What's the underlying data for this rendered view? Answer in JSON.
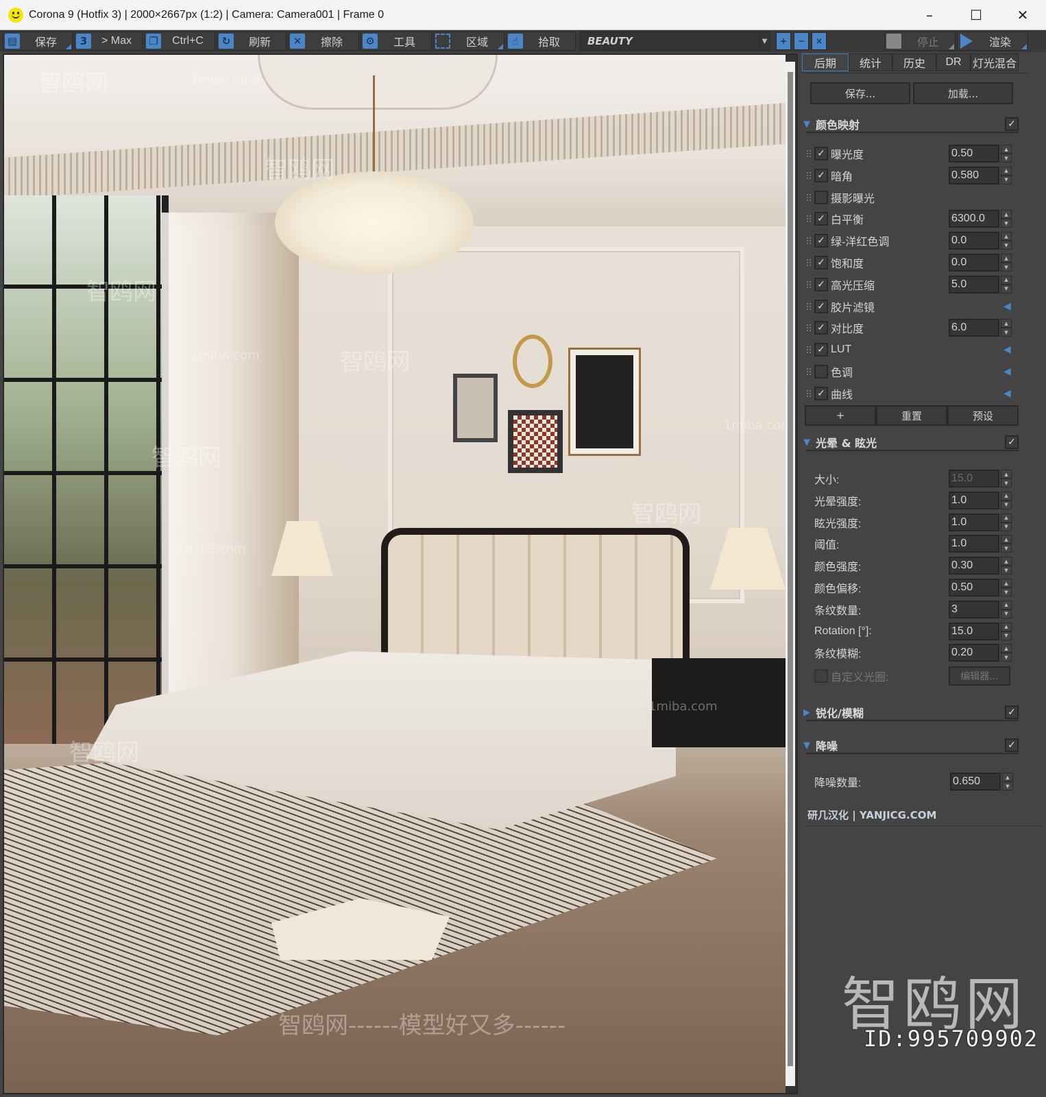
{
  "window": {
    "title": "Corona 9 (Hotfix 3) | 2000×2667px (1:2) | Camera: Camera001 | Frame 0",
    "app_icon": "smiley-icon",
    "controls": {
      "minimize": "–",
      "maximize": "☐",
      "close": "✕"
    }
  },
  "toolbar": {
    "buttons": [
      {
        "icon": "save-icon",
        "glyph": "▤",
        "label": "保存",
        "has_menu": true
      },
      {
        "icon": "max-icon",
        "glyph": "3",
        "label": "> Max",
        "has_menu": false
      },
      {
        "icon": "copy-icon",
        "glyph": "❐",
        "label": "Ctrl+C",
        "has_menu": false
      },
      {
        "icon": "refresh-icon",
        "glyph": "↻",
        "label": "刷新",
        "has_menu": false
      },
      {
        "icon": "erase-icon",
        "glyph": "✕",
        "label": "擦除",
        "has_menu": false
      },
      {
        "icon": "gear-icon",
        "glyph": "⚙",
        "label": "工具",
        "has_menu": false
      },
      {
        "icon": "region-icon",
        "glyph": "",
        "label": "区域",
        "has_menu": true
      },
      {
        "icon": "pick-icon",
        "glyph": "☝",
        "label": "拾取",
        "has_menu": false
      }
    ],
    "render_pass": "BEAUTY",
    "zoom": {
      "in": "+",
      "out": "−",
      "reset": "×"
    },
    "stop_label": "停止",
    "render_label": "渲染"
  },
  "viewport": {
    "watermarks": {
      "main": "智鸥网",
      "site": "1miba.com",
      "slogan": "智鸥网------模型好又多------"
    }
  },
  "panel": {
    "tabs": [
      {
        "label": "后期",
        "active": true
      },
      {
        "label": "统计",
        "active": false
      },
      {
        "label": "历史",
        "active": false
      },
      {
        "label": "DR",
        "active": false
      },
      {
        "label": "灯光混合",
        "active": false
      }
    ],
    "save_label": "保存...",
    "load_label": "加载...",
    "tone_mapping": {
      "title": "颜色映射",
      "enabled": true,
      "rows": [
        {
          "label": "曝光度",
          "checked": true,
          "value": "0.50"
        },
        {
          "label": "暗角",
          "checked": true,
          "value": "0.580"
        },
        {
          "label": "摄影曝光",
          "checked": false,
          "value": null
        },
        {
          "label": "白平衡",
          "checked": true,
          "value": "6300.0"
        },
        {
          "label": "绿-洋红色调",
          "checked": true,
          "value": "0.0"
        },
        {
          "label": "饱和度",
          "checked": true,
          "value": "0.0"
        },
        {
          "label": "高光压缩",
          "checked": true,
          "value": "5.0"
        },
        {
          "label": "胶片滤镜",
          "checked": true,
          "value": null,
          "expand": true
        },
        {
          "label": "对比度",
          "checked": true,
          "value": "6.0"
        },
        {
          "label": "LUT",
          "checked": true,
          "value": null,
          "expand": true
        },
        {
          "label": "色调",
          "checked": false,
          "value": null,
          "expand": true
        },
        {
          "label": "曲线",
          "checked": true,
          "value": null,
          "expand": true
        }
      ],
      "add_label": "+",
      "reset_label": "重置",
      "preset_label": "预设"
    },
    "bloom_glare": {
      "title": "光晕 & 眩光",
      "enabled": true,
      "rows": [
        {
          "label": "大小:",
          "value": "15.0",
          "disabled": true
        },
        {
          "label": "光晕强度:",
          "value": "1.0"
        },
        {
          "label": "眩光强度:",
          "value": "1.0"
        },
        {
          "label": "阈值:",
          "value": "1.0"
        },
        {
          "label": "颜色强度:",
          "value": "0.30"
        },
        {
          "label": "颜色偏移:",
          "value": "0.50"
        },
        {
          "label": "条纹数量:",
          "value": "3"
        },
        {
          "label": "Rotation [°]:",
          "value": "15.0"
        },
        {
          "label": "条纹模糊:",
          "value": "0.20"
        }
      ],
      "custom_aperture_label": "自定义光圈:",
      "custom_aperture_checked": false,
      "editor_label": "编辑器..."
    },
    "sharpen_blur": {
      "title": "锐化/模糊",
      "enabled": true,
      "collapsed": true
    },
    "denoise": {
      "title": "降噪",
      "enabled": true,
      "amount_label": "降噪数量:",
      "amount_value": "0.650"
    },
    "footer_brand": "研几汉化 | YANJICG.COM",
    "watermark_brand": "智鸥网",
    "watermark_id": "ID:995709902"
  },
  "colors": {
    "accent": "#4a86c8",
    "panel_bg": "#444444",
    "toolbar_bg": "#3a3a3a",
    "titlebar_bg": "#f3f3f3"
  }
}
